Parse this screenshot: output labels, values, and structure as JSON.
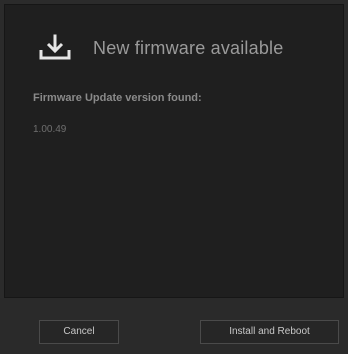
{
  "dialog": {
    "title": "New firmware available",
    "icon": "download-tray-icon"
  },
  "firmware": {
    "label": "Firmware Update version found:",
    "version": "1.00.49"
  },
  "buttons": {
    "cancel_label": "Cancel",
    "install_label": "Install and Reboot"
  },
  "colors": {
    "background": "#2b2b2b",
    "panel": "#1f1f1f",
    "title_text": "#9a9a9a",
    "icon": "#e6e6e6"
  }
}
